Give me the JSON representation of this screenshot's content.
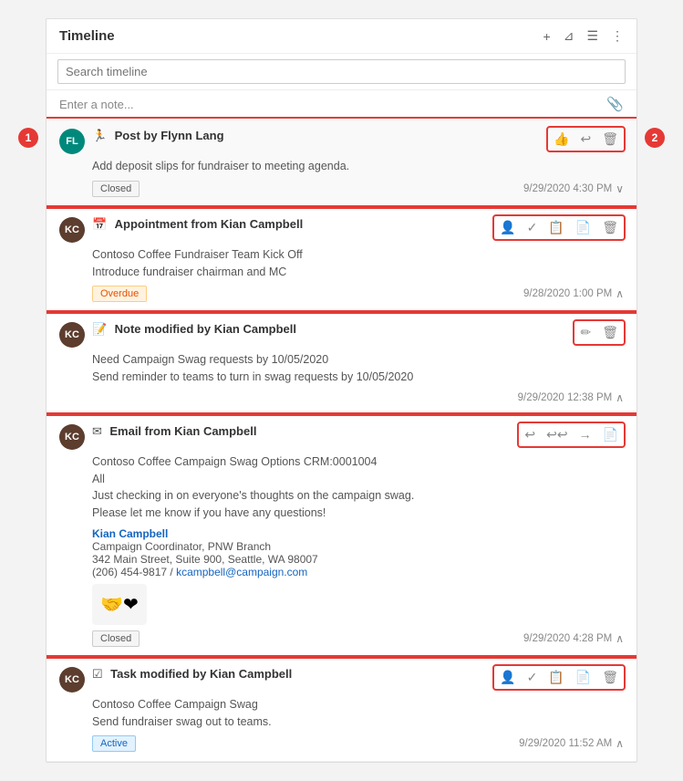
{
  "panel": {
    "title": "Timeline",
    "search_placeholder": "Search timeline",
    "note_placeholder": "Enter a note...",
    "header_icons": [
      "+",
      "⊿",
      "☰",
      "⋮"
    ]
  },
  "labels": {
    "left": "1",
    "right": "2"
  },
  "items": [
    {
      "id": "post-flynn",
      "type": "Post",
      "icon": "🏃",
      "title": "Post by Flynn Lang",
      "avatar": "FL",
      "avatar_class": "avatar-fl",
      "body": [
        "Add deposit slips for fundraiser to meeting agenda."
      ],
      "status": "Closed",
      "status_class": "closed",
      "timestamp": "9/29/2020 4:30 PM",
      "expanded": true,
      "actions": [
        "👍",
        "↩",
        "🗑"
      ]
    },
    {
      "id": "appointment-kian",
      "type": "Appointment",
      "icon": "📅",
      "title": "Appointment from Kian Campbell",
      "avatar": "KC",
      "avatar_class": "avatar-kc",
      "body": [
        "Contoso Coffee Fundraiser Team Kick Off",
        "Introduce fundraiser chairman and MC"
      ],
      "status": "Overdue",
      "status_class": "overdue",
      "timestamp": "9/28/2020 1:00 PM",
      "expanded": false,
      "actions": [
        "👤",
        "✓",
        "📋",
        "📄",
        "🗑"
      ]
    },
    {
      "id": "note-kian",
      "type": "Note",
      "icon": "📝",
      "title": "Note modified by Kian Campbell",
      "avatar": "KC",
      "avatar_class": "avatar-kc",
      "body": [
        "Need Campaign Swag requests by 10/05/2020",
        "Send reminder to teams to turn in swag requests by 10/05/2020"
      ],
      "status": null,
      "timestamp": "9/29/2020 12:38 PM",
      "expanded": false,
      "actions": [
        "✏",
        "🗑"
      ]
    },
    {
      "id": "email-kian",
      "type": "Email",
      "icon": "✉",
      "title": "Email from Kian Campbell",
      "avatar": "KC",
      "avatar_class": "avatar-kc",
      "body": [
        "Contoso Coffee Campaign Swag Options CRM:0001004",
        "All",
        "Just checking in on everyone's thoughts on the campaign swag.",
        "Please let me know if you have any questions!"
      ],
      "signature": {
        "name": "Kian Campbell",
        "title": "Campaign Coordinator, PNW Branch",
        "address": "342 Main Street, Suite 900, Seattle, WA 98007",
        "phone": "(206) 454-9817 /",
        "email": "kcampbell@campaign.com"
      },
      "status": "Closed",
      "status_class": "closed",
      "timestamp": "9/29/2020 4:28 PM",
      "expanded": false,
      "actions": [
        "↩",
        "↩↩",
        "→",
        "📄"
      ]
    },
    {
      "id": "task-kian",
      "type": "Task",
      "icon": "☑",
      "title": "Task modified by Kian Campbell",
      "avatar": "KC",
      "avatar_class": "avatar-kc",
      "body": [
        "Contoso Coffee Campaign Swag",
        "Send fundraiser swag out to teams."
      ],
      "status": "Active",
      "status_class": "active",
      "timestamp": "9/29/2020 11:52 AM",
      "expanded": false,
      "actions": [
        "👤",
        "✓",
        "📋",
        "📄",
        "🗑"
      ]
    }
  ]
}
